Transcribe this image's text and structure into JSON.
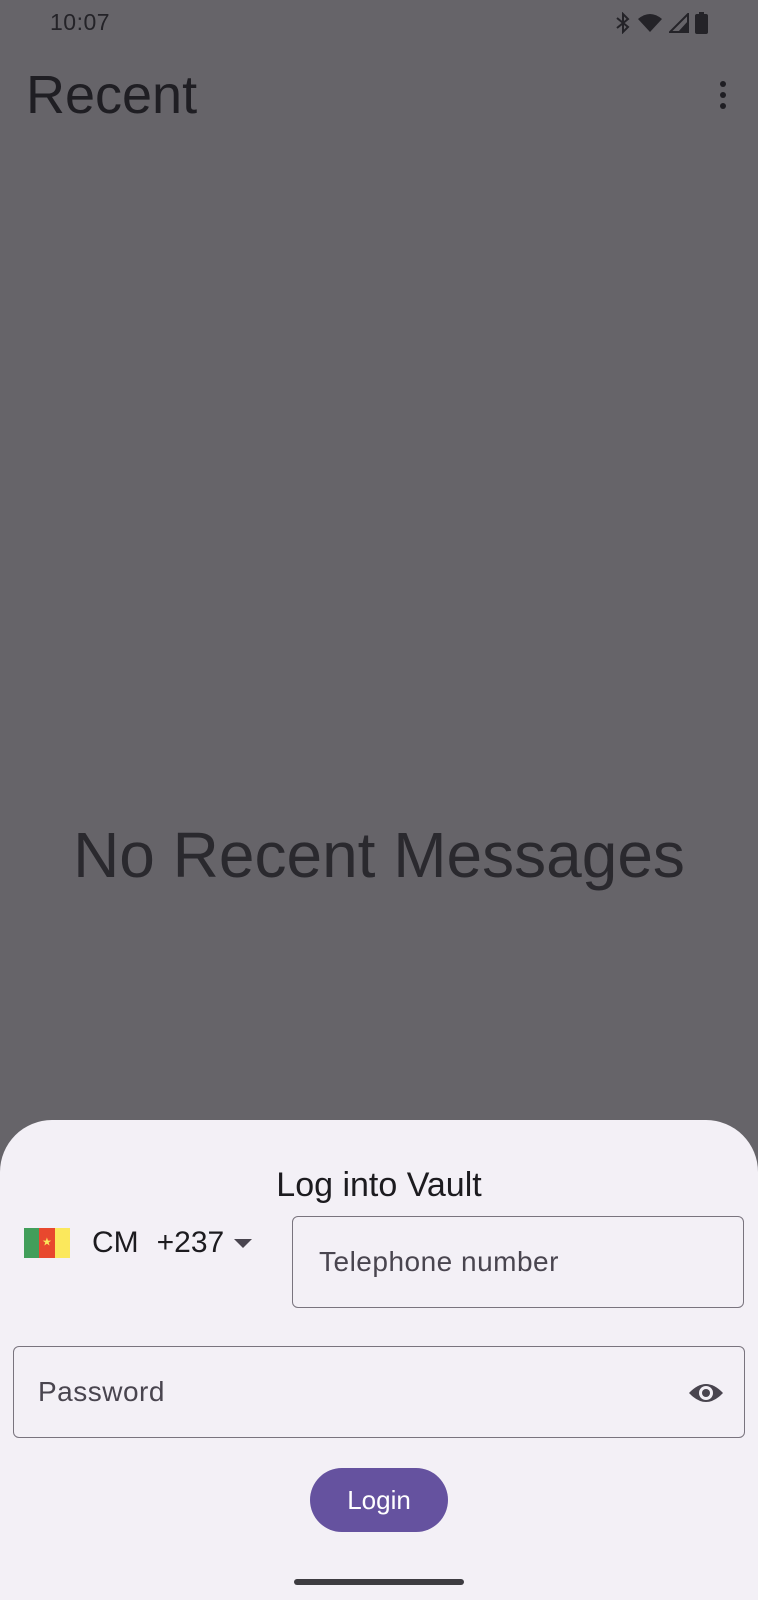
{
  "status_bar": {
    "time": "10:07",
    "icons": [
      "bluetooth-icon",
      "wifi-icon",
      "cell-signal-icon",
      "battery-icon"
    ]
  },
  "app_bar": {
    "title": "Recent",
    "menu_icon": "more-vert-icon"
  },
  "main": {
    "empty_message": "No Recent Messages"
  },
  "login_sheet": {
    "title": "Log into Vault",
    "country": {
      "code": "CM",
      "dial_code": "+237",
      "flag_colors": [
        "#419e5a",
        "#e8482e",
        "#fbe85c"
      ]
    },
    "phone": {
      "placeholder": "Telephone number",
      "value": ""
    },
    "password": {
      "placeholder": "Password",
      "value": "",
      "toggle_icon": "eye-icon"
    },
    "login_label": "Login"
  },
  "colors": {
    "scrim": "#666469",
    "sheet_background": "#f3f0f6",
    "primary": "#65529f"
  }
}
